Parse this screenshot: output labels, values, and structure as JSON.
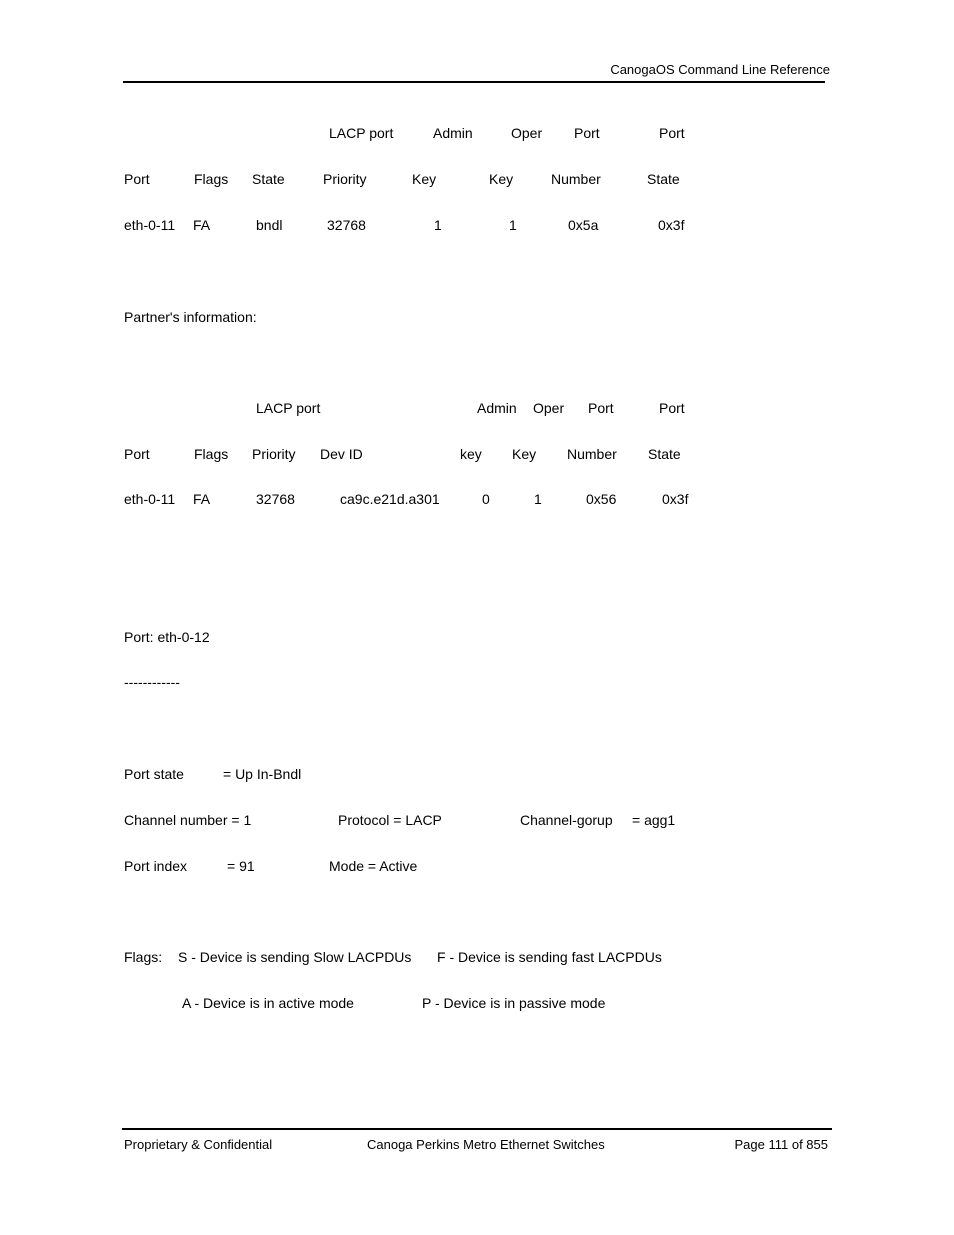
{
  "header": {
    "title": "CanogaOS Command Line Reference"
  },
  "actor_table": {
    "header_row1": [
      "LACP port",
      "Admin",
      "Oper",
      "Port",
      "Port"
    ],
    "header_row2": [
      "Port",
      "Flags",
      "State",
      "Priority",
      "Key",
      "Key",
      "Number",
      "State"
    ],
    "rows": [
      [
        "eth-0-11",
        "FA",
        "bndl",
        "32768",
        "1",
        "1",
        "0x5a",
        "0x3f"
      ]
    ]
  },
  "partner_label": "Partner's information:",
  "partner_table": {
    "header_row1": [
      "LACP port",
      "Admin",
      "Oper",
      "Port",
      "Port"
    ],
    "header_row2": [
      "Port",
      "Flags",
      "Priority",
      "Dev ID",
      "key",
      "Key",
      "Number",
      "State"
    ],
    "rows": [
      [
        "eth-0-11",
        "FA",
        "32768",
        "ca9c.e21d.a301",
        "0",
        "1",
        "0x56",
        "0x3f"
      ]
    ]
  },
  "port_section": {
    "title": "Port: eth-0-12",
    "separator": "------------",
    "port_state_label": "Port state",
    "port_state_value": "= Up In-Bndl",
    "channel_number": "Channel number = 1",
    "protocol": "Protocol = LACP",
    "channel_group_label": "Channel-gorup",
    "channel_group_value": "= agg1",
    "port_index_label": "Port index",
    "port_index_value": "= 91",
    "mode": "Mode = Active"
  },
  "flags_legend": {
    "label": "Flags:",
    "items": [
      "S - Device is sending Slow LACPDUs",
      "F - Device is sending fast LACPDUs",
      "A - Device is in active mode",
      "P - Device is in passive mode"
    ]
  },
  "footer": {
    "left": "Proprietary & Confidential",
    "center": "Canoga Perkins Metro Ethernet Switches",
    "right": "Page 111 of 855"
  }
}
